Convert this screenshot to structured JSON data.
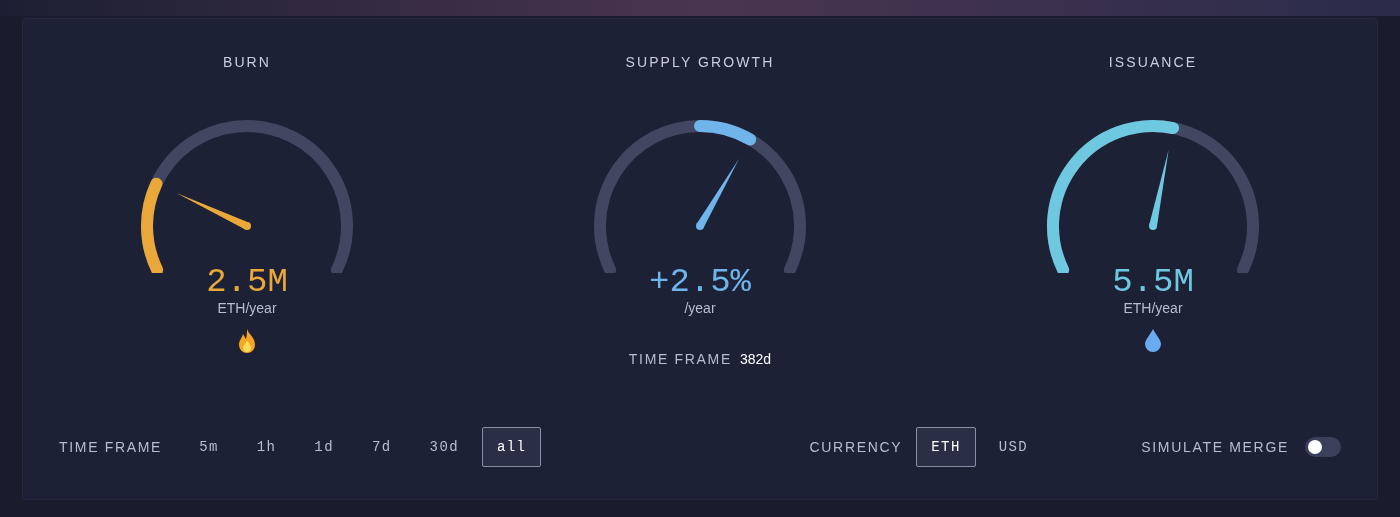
{
  "gauges": [
    {
      "title": "BURN",
      "kind": "from_start",
      "color": "#eba83a",
      "value": "2.5M",
      "unit": "ETH/year",
      "footer": {
        "kind": "flame"
      }
    },
    {
      "title": "SUPPLY GROWTH",
      "kind": "from_middle",
      "color": "#6fb4ea",
      "value": "+2.5%",
      "unit": "/year",
      "footer": {
        "kind": "time_frame",
        "label": "TIME FRAME",
        "value": "382d"
      }
    },
    {
      "title": "ISSUANCE",
      "kind": "from_start",
      "color": "#6ec8e0",
      "value": "5.5M",
      "unit": "ETH/year",
      "footer": {
        "kind": "drop"
      }
    }
  ],
  "time_frame": {
    "label": "TIME FRAME",
    "options": [
      {
        "label": "5m",
        "selected": false
      },
      {
        "label": "1h",
        "selected": false
      },
      {
        "label": "1d",
        "selected": false
      },
      {
        "label": "7d",
        "selected": false
      },
      {
        "label": "30d",
        "selected": false
      },
      {
        "label": "all",
        "selected": true
      }
    ]
  },
  "currency": {
    "label": "CURRENCY",
    "options": [
      {
        "label": "ETH",
        "selected": true
      },
      {
        "label": "USD",
        "selected": false
      }
    ]
  },
  "simulate_merge": {
    "label": "SIMULATE MERGE",
    "on": false
  }
}
